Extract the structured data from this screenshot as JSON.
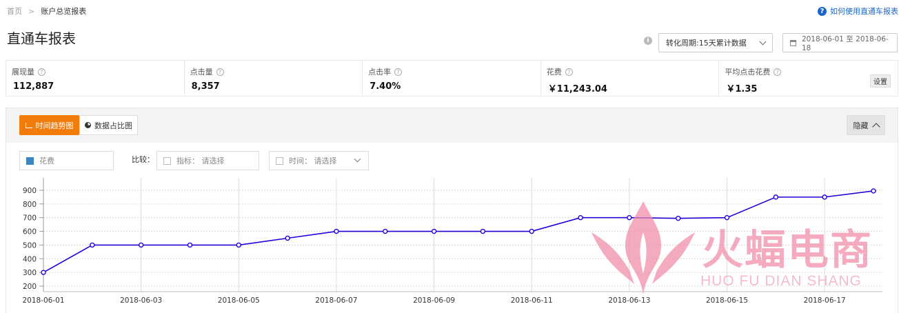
{
  "breadcrumb": {
    "home": "首页",
    "current": "账户总览报表"
  },
  "help_link": "如何使用直通车报表",
  "page_title": "直通车报表",
  "cycle_select": "转化周期:15天累计数据",
  "date_range": "2018-06-01 至 2018-06-18",
  "metrics": [
    {
      "label": "展现量",
      "value": "112,887"
    },
    {
      "label": "点击量",
      "value": "8,357"
    },
    {
      "label": "点击率",
      "value": "7.40%"
    },
    {
      "label": "花费",
      "value": "￥11,243.04"
    },
    {
      "label": "平均点击花费",
      "value": "￥1.35"
    }
  ],
  "settings_label": "设置",
  "tabs": {
    "trend": "时间趋势图",
    "ratio": "数据占比图"
  },
  "hide_label": "隐藏",
  "series_selector": "花费",
  "compare_label": "比较：",
  "compare_metric": "指标：  请选择",
  "compare_time": "时间：  请选择",
  "watermark": {
    "main": "火蝠电商",
    "sub": "HUO FU DIAN SHANG"
  },
  "colors": {
    "accent": "#f27c0a",
    "line": "#2200dd",
    "link": "#1a66c8"
  },
  "chart_data": {
    "type": "line",
    "x": [
      "2018-06-01",
      "2018-06-02",
      "2018-06-03",
      "2018-06-04",
      "2018-06-05",
      "2018-06-06",
      "2018-06-07",
      "2018-06-08",
      "2018-06-09",
      "2018-06-10",
      "2018-06-11",
      "2018-06-12",
      "2018-06-13",
      "2018-06-14",
      "2018-06-15",
      "2018-06-16",
      "2018-06-17",
      "2018-06-18"
    ],
    "x_tick_labels": [
      "2018-06-01",
      "2018-06-03",
      "2018-06-05",
      "2018-06-07",
      "2018-06-09",
      "2018-06-11",
      "2018-06-13",
      "2018-06-15",
      "2018-06-17"
    ],
    "series": [
      {
        "name": "花费",
        "values": [
          300,
          500,
          500,
          500,
          500,
          550,
          600,
          600,
          600,
          600,
          600,
          700,
          700,
          695,
          700,
          850,
          850,
          895
        ]
      }
    ],
    "y_ticks": [
      200,
      300,
      400,
      500,
      600,
      700,
      800,
      900
    ],
    "ylim": [
      190,
      940
    ],
    "grid": true
  }
}
